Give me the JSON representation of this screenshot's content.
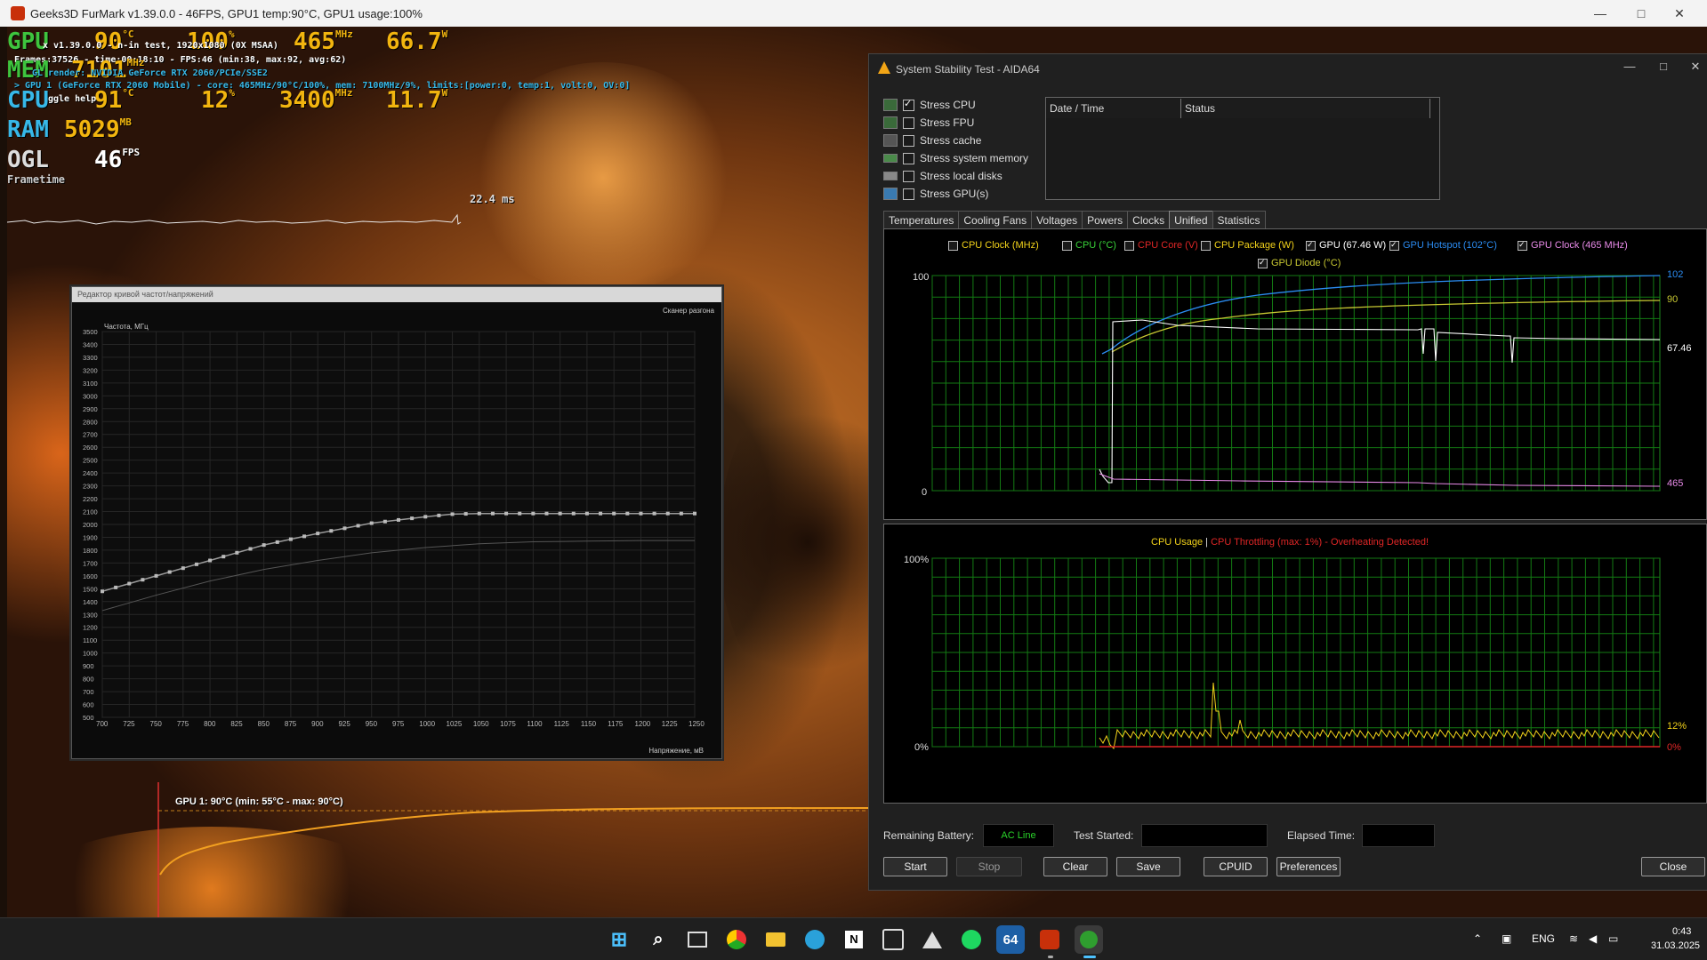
{
  "furmark": {
    "title": "Geeks3D FurMark v1.39.0.0 - 46FPS, GPU1 temp:90°C, GPU1 usage:100%",
    "hud": {
      "gpu": {
        "label": "GPU",
        "temp": "90",
        "temp_unit": "°C",
        "usage": "100",
        "usage_unit": "%",
        "clock": "465",
        "clock_unit": "MHz",
        "power": "66.7",
        "power_unit": "W"
      },
      "mem": {
        "label": "MEM",
        "value": "7101",
        "unit": "MHz"
      },
      "cpu": {
        "label": "CPU",
        "temp": "91",
        "temp_unit": "°C",
        "usage": "12",
        "usage_unit": "%",
        "clock": "3400",
        "clock_unit": "MHz",
        "power": "11.7",
        "power_unit": "W"
      },
      "ram": {
        "label": "RAM",
        "value": "5029",
        "unit": "MB"
      },
      "ogl": {
        "label": "OGL",
        "value": "46",
        "unit": "FPS"
      },
      "frametime_label": "Frametime",
      "frametime_value": "22.4 ms",
      "line1": "x v1.39.0.0 - n-in test, 1920x1080 (0X MSAA)",
      "line2": "Frames:37526 - time:00:18:10 - FPS:46 (min:38, max:92, avg:62)",
      "line3": "GL render: NVIDIA GeForce RTX 2060/PCIe/SSE2",
      "line4": "> GPU 1 (GeForce RTX 2060 Mobile) - core: 465MHz/90°C/100%, mem: 7100MHz/9%, limits:[power:0, temp:1, volt:0, OV:0]",
      "line5": "ggle help"
    },
    "gpu_temp_graph": "GPU 1: 90°C (min: 55°C - max: 90°C)"
  },
  "curve_editor": {
    "title": "Редактор кривой частот/напряжений",
    "scanner": "Сканер разгона",
    "ylabel": "Частота, МГц",
    "xlabel": "Напряжение, мВ"
  },
  "chart_data": [
    {
      "type": "line",
      "title": "",
      "xlabel": "Напряжение, мВ",
      "ylabel": "Частота, МГц",
      "x_ticks": [
        700,
        725,
        750,
        775,
        800,
        825,
        850,
        875,
        900,
        925,
        950,
        975,
        1000,
        1025,
        1050,
        1075,
        1100,
        1125,
        1150,
        1175,
        1200,
        1225,
        1250
      ],
      "y_ticks": [
        500,
        600,
        700,
        800,
        900,
        1000,
        1100,
        1200,
        1300,
        1400,
        1500,
        1600,
        1700,
        1800,
        1900,
        2000,
        2100,
        2200,
        2300,
        2400,
        2500,
        2600,
        2700,
        2800,
        2900,
        3000,
        3100,
        3200,
        3300,
        3400,
        3500
      ],
      "xlim": [
        700,
        1250
      ],
      "ylim": [
        500,
        3500
      ],
      "series": [
        {
          "x": [
            700,
            750,
            800,
            850,
            900,
            950,
            1000,
            1025,
            1050,
            1100,
            1150,
            1200,
            1250
          ],
          "values": [
            1480,
            1600,
            1720,
            1840,
            1930,
            2010,
            2060,
            2080,
            2085,
            2085,
            2085,
            2085,
            2085
          ]
        },
        {
          "x": [
            700,
            750,
            800,
            850,
            900,
            950,
            1000,
            1050,
            1100,
            1150,
            1200,
            1250
          ],
          "values": [
            1330,
            1450,
            1560,
            1650,
            1720,
            1780,
            1820,
            1850,
            1865,
            1870,
            1875,
            1875
          ]
        }
      ]
    },
    {
      "type": "line",
      "title": "",
      "ylim": [
        0,
        100
      ],
      "y_ticks_left": [
        "100",
        "0"
      ],
      "right_labels": [
        "102",
        "90",
        "67.46",
        "465"
      ],
      "series_visible": [
        "GPU (67.46 W)",
        "GPU Hotspot (102°C)",
        "GPU Clock (465 MHz)",
        "GPU Diode (°C)"
      ]
    },
    {
      "type": "line",
      "title": "",
      "ylim": [
        0,
        100
      ],
      "y_ticks_left": [
        "100%",
        "0%"
      ],
      "right_labels": [
        "12%",
        "0%"
      ],
      "series_visible": [
        "CPU Usage",
        "CPU Throttling (max: 1%) - Overheating Detected!"
      ]
    }
  ],
  "aida": {
    "title": "System Stability Test - AIDA64",
    "stress": [
      {
        "label": "Stress CPU",
        "checked": true
      },
      {
        "label": "Stress FPU",
        "checked": false
      },
      {
        "label": "Stress cache",
        "checked": false
      },
      {
        "label": "Stress system memory",
        "checked": false
      },
      {
        "label": "Stress local disks",
        "checked": false
      },
      {
        "label": "Stress GPU(s)",
        "checked": false
      }
    ],
    "table_headers": [
      "Date / Time",
      "Status"
    ],
    "tabs": [
      "Temperatures",
      "Cooling Fans",
      "Voltages",
      "Powers",
      "Clocks",
      "Unified",
      "Statistics"
    ],
    "active_tab": "Unified",
    "legend": [
      {
        "label": "CPU Clock (MHz)",
        "checked": false,
        "color": "#f2d21a"
      },
      {
        "label": "CPU (°C)",
        "checked": false,
        "color": "#39d339"
      },
      {
        "label": "CPU Core (V)",
        "checked": false,
        "color": "#e02626"
      },
      {
        "label": "CPU Package (W)",
        "checked": false,
        "color": "#f2d21a"
      },
      {
        "label": "GPU (67.46 W)",
        "checked": true,
        "color": "#ffffff"
      },
      {
        "label": "GPU Hotspot (102°C)",
        "checked": true,
        "color": "#2b8cf2"
      },
      {
        "label": "GPU Clock (465 MHz)",
        "checked": true,
        "color": "#e88ae8"
      },
      {
        "label": "GPU Diode (°C)",
        "checked": true,
        "color": "#c8c832"
      }
    ],
    "graph1": {
      "y_top": "100",
      "y_bottom": "0",
      "right_102": "102",
      "right_90": "90",
      "right_67": "67.46",
      "right_465": "465"
    },
    "graph2": {
      "y_top": "100%",
      "y_bottom": "0%",
      "right_12": "12%",
      "right_0": "0%",
      "title_usage": "CPU Usage",
      "title_sep": "|",
      "title_throttle": "CPU Throttling (max: 1%) - Overheating Detected!"
    },
    "bottom": {
      "battery_label": "Remaining Battery:",
      "battery_value": "AC Line",
      "started_label": "Test Started:",
      "started_value": "",
      "elapsed_label": "Elapsed Time:",
      "elapsed_value": ""
    },
    "buttons": {
      "start": "Start",
      "stop": "Stop",
      "clear": "Clear",
      "save": "Save",
      "cpuid": "CPUID",
      "preferences": "Preferences",
      "close": "Close"
    }
  },
  "taskbar": {
    "lang": "ENG",
    "time": "0:43",
    "date": "31.03.2025",
    "apps": [
      "start-icon",
      "search-icon",
      "task-view-icon",
      "chrome-icon",
      "explorer-icon",
      "telegram-icon",
      "notion-icon",
      "calendar-icon",
      "app-icon",
      "spotify-icon",
      "aida64-icon",
      "furmark-icon",
      "xbox-icon"
    ],
    "aida_label": "64"
  }
}
